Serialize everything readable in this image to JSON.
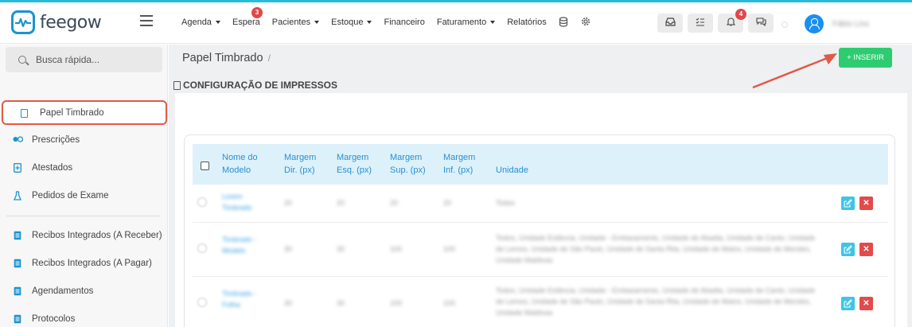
{
  "brand": {
    "name": "feegow",
    "accent": "#1b93d1",
    "topline": "#27bcd6"
  },
  "nav": [
    {
      "label": "Agenda",
      "dropdown": true
    },
    {
      "label": "Espera",
      "badge": "3"
    },
    {
      "label": "Pacientes",
      "dropdown": true
    },
    {
      "label": "Estoque",
      "dropdown": true
    },
    {
      "label": "Financeiro"
    },
    {
      "label": "Faturamento",
      "dropdown": true
    },
    {
      "label": "Relatórios"
    }
  ],
  "header_icons": {
    "database": "database-icon",
    "settings": "gear-icon"
  },
  "header_buttons": {
    "inbox": "inbox-icon",
    "tasks": "checklist-icon",
    "notifications": "bell-icon",
    "notifications_badge": "4",
    "chat": "chat-icon"
  },
  "user": {
    "name": "Fábio Lins"
  },
  "sidebar": {
    "search_placeholder": "Busca rápida...",
    "items": [
      {
        "label": "Papel Timbrado",
        "icon": "file-icon",
        "active": true
      },
      {
        "label": "Prescrições",
        "icon": "pills-icon"
      },
      {
        "label": "Atestados",
        "icon": "file-plus-icon"
      },
      {
        "label": "Pedidos de Exame",
        "icon": "flask-icon"
      },
      {
        "label": "Recibos Integrados (A Receber)",
        "icon": "file-text-icon"
      },
      {
        "label": "Recibos Integrados (A Pagar)",
        "icon": "file-text-icon"
      },
      {
        "label": "Agendamentos",
        "icon": "file-text-icon"
      },
      {
        "label": "Protocolos",
        "icon": "file-text-icon"
      }
    ]
  },
  "main": {
    "breadcrumb": "Papel Timbrado",
    "breadcrumb_sep": "/",
    "insert_label": "+ INSERIR",
    "section_title": "CONFIGURAÇÃO DE IMPRESSOS",
    "table": {
      "headers": {
        "name": "Nome do Modelo",
        "margin_right": "Margem Dir. (px)",
        "margin_left": "Margem Esq. (px)",
        "margin_top": "Margem Sup. (px)",
        "margin_bottom": "Margem Inf. (px)",
        "unit": "Unidade"
      },
      "rows": [
        {
          "name": "Lorem Timbrado",
          "right": "20",
          "left": "20",
          "top": "20",
          "bottom": "20",
          "unit": "Todos"
        },
        {
          "name": "Timbrado - Modelo",
          "right": "30",
          "left": "30",
          "top": "100",
          "bottom": "100",
          "unit": "Todos, Unidade Estância, Unidade - Embasamento, Unidade de Abadia, Unidade de Canto, Unidade de Lemos, Unidade de São Paulo, Unidade de Santa Rita, Unidade de Matos, Unidade de Mendes, Unidade Maldivas"
        },
        {
          "name": "Timbrado - Folha",
          "right": "30",
          "left": "30",
          "top": "100",
          "bottom": "100",
          "unit": "Todos, Unidade Estância, Unidade - Embasamento, Unidade de Abadia, Unidade de Canto, Unidade de Lemos, Unidade de São Paulo, Unidade de Santa Rita, Unidade de Matos, Unidade de Mendes, Unidade Maldivas"
        }
      ]
    }
  }
}
